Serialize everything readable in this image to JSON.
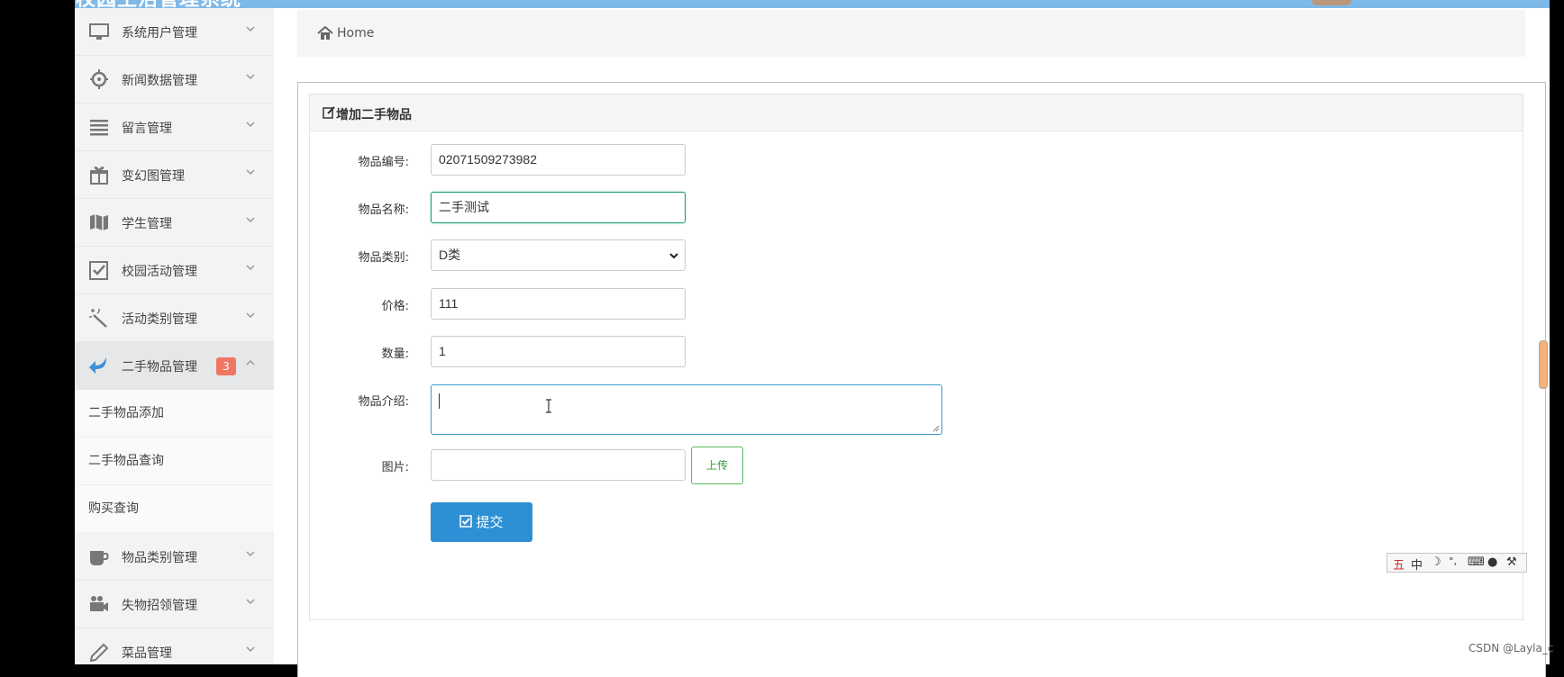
{
  "app": {
    "title": "校园生活管理系统"
  },
  "sidebar": {
    "items": [
      {
        "label": "系统用户管理",
        "icon": "monitor-icon"
      },
      {
        "label": "新闻数据管理",
        "icon": "crosshair-icon"
      },
      {
        "label": "留言管理",
        "icon": "list-icon"
      },
      {
        "label": "变幻图管理",
        "icon": "gift-icon"
      },
      {
        "label": "学生管理",
        "icon": "map-icon"
      },
      {
        "label": "校园活动管理",
        "icon": "checkbox-icon"
      },
      {
        "label": "活动类别管理",
        "icon": "magic-wand-icon"
      },
      {
        "label": "二手物品管理",
        "icon": "reply-arrow-icon",
        "badge": "3"
      },
      {
        "label": "物品类别管理",
        "icon": "cup-icon"
      },
      {
        "label": "失物招领管理",
        "icon": "video-icon"
      },
      {
        "label": "菜品管理",
        "icon": "pencil-icon"
      }
    ],
    "submenu": [
      "二手物品添加",
      "二手物品查询",
      "购买查询"
    ]
  },
  "breadcrumb": {
    "home": "Home"
  },
  "panel": {
    "title": "增加二手物品"
  },
  "form": {
    "code_label": "物品编号:",
    "code_value": "02071509273982",
    "name_label": "物品名称:",
    "name_value": "二手测试",
    "category_label": "物品类别:",
    "category_value": "D类",
    "price_label": "价格:",
    "price_value": "111",
    "qty_label": "数量:",
    "qty_value": "1",
    "desc_label": "物品介绍:",
    "desc_value": "",
    "image_label": "图片:",
    "image_value": "",
    "upload_label": "上传",
    "submit_label": "提交"
  },
  "ime": {
    "lang": "中",
    "mode": "五"
  },
  "watermark": "CSDN @Layla_c"
}
